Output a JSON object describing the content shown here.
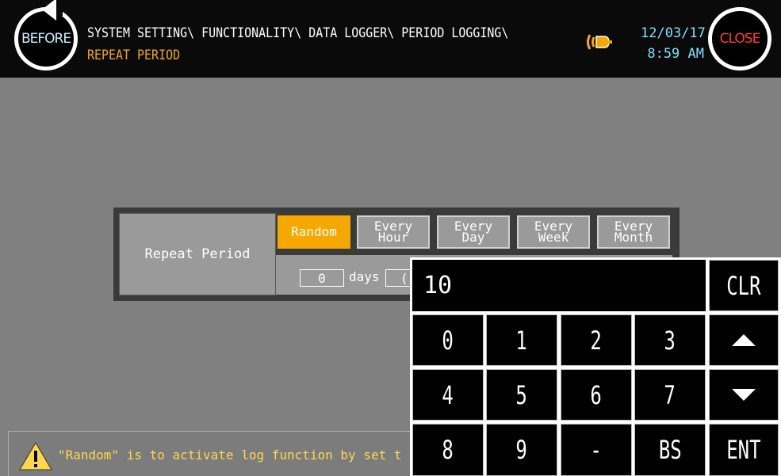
{
  "header": {
    "before_label": "BEFORE",
    "close_label": "CLOSE",
    "path_line1": "SYSTEM SETTING\\ FUNCTIONALITY\\ DATA LOGGER\\ PERIOD LOGGING\\",
    "path_line2": "REPEAT PERIOD",
    "date": "12/03/17",
    "time": "8:59 AM",
    "alarm_icon": "alarm-bell-icon"
  },
  "repeat_panel": {
    "label": "Repeat Period",
    "tabs": [
      {
        "label_1": "Random",
        "label_2": ""
      },
      {
        "label_1": "Every",
        "label_2": "Hour"
      },
      {
        "label_1": "Every",
        "label_2": "Day"
      },
      {
        "label_1": "Every",
        "label_2": "Week"
      },
      {
        "label_1": "Every",
        "label_2": "Month"
      }
    ],
    "active_tab": "Random",
    "days_value": "0",
    "days_unit": "days",
    "next_value_partial": "("
  },
  "keypad": {
    "display_value": "10",
    "keys": {
      "k0": "0",
      "k1": "1",
      "k2": "2",
      "k3": "3",
      "k4": "4",
      "k5": "5",
      "k6": "6",
      "k7": "7",
      "k8": "8",
      "k9": "9",
      "minus": "-",
      "bs": "BS",
      "clr": "CLR",
      "ent": "ENT"
    }
  },
  "message": {
    "text": "\"Random\" is to activate log function by set t",
    "icon": "warning-icon"
  },
  "colors": {
    "accent": "#f5a900",
    "background": "#808080",
    "header": "#0a0a0a",
    "close": "#ff3b2f"
  }
}
